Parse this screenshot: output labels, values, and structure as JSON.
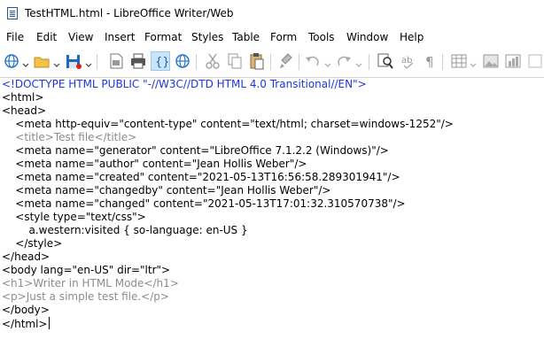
{
  "window": {
    "title": "TestHTML.html - LibreOffice Writer/Web"
  },
  "menu": [
    "File",
    "Edit",
    "View",
    "Insert",
    "Format",
    "Styles",
    "Table",
    "Form",
    "Tools",
    "Window",
    "Help"
  ],
  "toolbar": {
    "icons": [
      "globe-icon",
      "open-folder-icon",
      "save-icon",
      "export-pdf-icon",
      "print-icon",
      "html-source-icon",
      "web-view-icon",
      "cut-icon",
      "copy-icon",
      "paste-icon",
      "clone-formatting-icon",
      "undo-icon",
      "redo-icon",
      "find-replace-icon",
      "spelling-icon",
      "formatting-marks-icon",
      "insert-table-icon",
      "insert-image-icon",
      "insert-chart-icon"
    ],
    "accent": "#cce4f7"
  },
  "source": {
    "lines": [
      "<!DOCTYPE HTML PUBLIC \"-//W3C//DTD HTML 4.0 Transitional//EN\">",
      "<html>",
      "<head>",
      "    <meta http-equiv=\"content-type\" content=\"text/html; charset=windows-1252\"/>",
      "    <title>Test file</title>",
      "    <meta name=\"generator\" content=\"LibreOffice 7.1.2.2 (Windows)\"/>",
      "    <meta name=\"author\" content=\"Jean Hollis Weber\"/>",
      "    <meta name=\"created\" content=\"2021-05-13T16:56:58.289301941\"/>",
      "    <meta name=\"changedby\" content=\"Jean Hollis Weber\"/>",
      "    <meta name=\"changed\" content=\"2021-05-13T17:01:32.310570738\"/>",
      "    <style type=\"text/css\">",
      "        a.western:visited { so-language: en-US }",
      "    </style>",
      "</head>",
      "<body lang=\"en-US\" dir=\"ltr\">",
      "<h1>Writer in HTML Mode</h1>",
      "<p>Just a simple test file.</p>",
      "</body>",
      "</html>"
    ],
    "colors": {
      "doctype": "#1c36e0",
      "tag": "#000000",
      "content": "#8c8c8c"
    }
  }
}
